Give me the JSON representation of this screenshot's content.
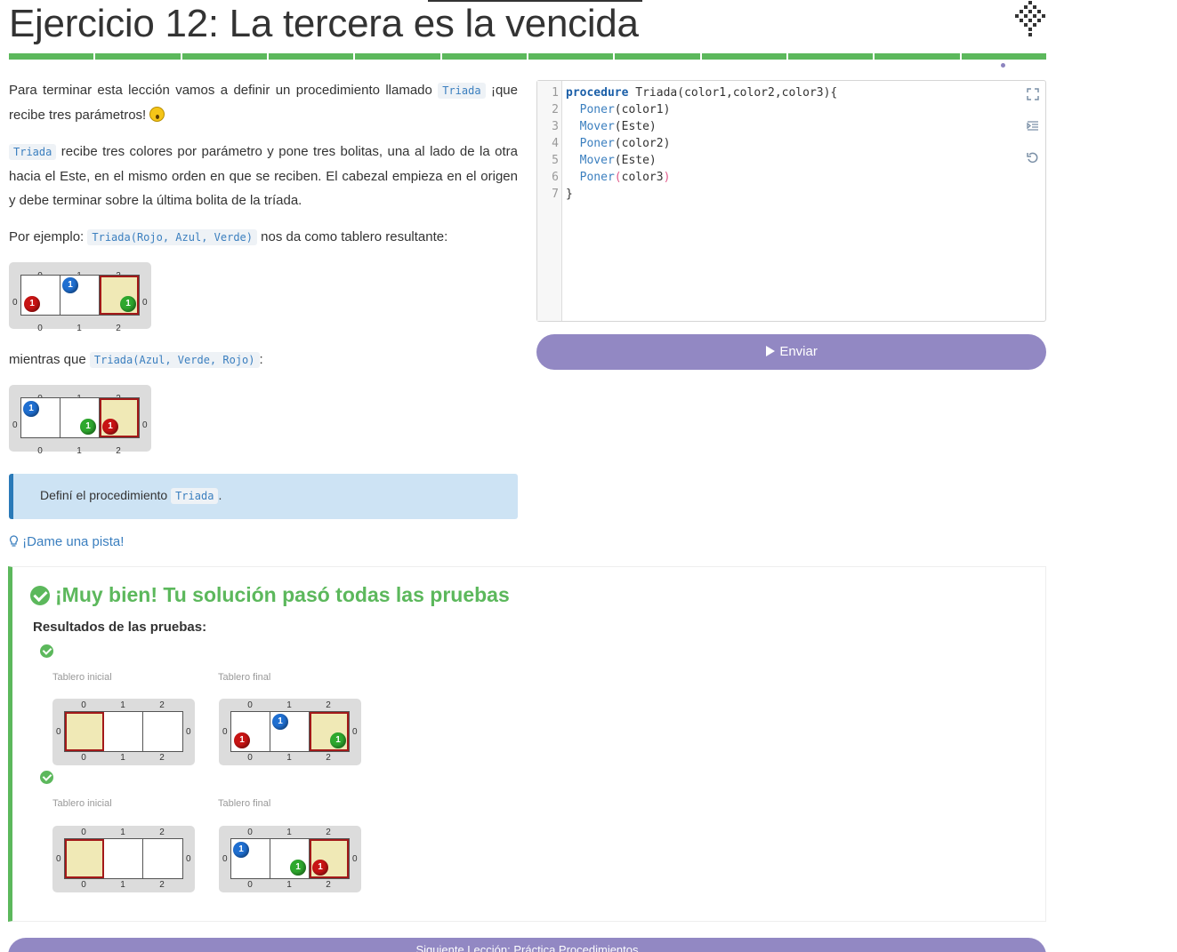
{
  "header": {
    "title": "Ejercicio 12: La tercera es la vencida",
    "progress_segments": 12
  },
  "statement": {
    "p1_before": "Para terminar esta lección vamos a definir un procedimiento llamado ",
    "p1_code": "Triada",
    "p1_after": " ¡que recibe tres parámetros! ",
    "p2_code": "Triada",
    "p2_after": " recibe tres colores por parámetro y pone tres bolitas, una al lado de la otra hacia el Este, en el mismo orden en que se reciben. El cabezal empieza en el origen y debe terminar sobre la última bolita de la tríada.",
    "p3_before": "Por ejemplo: ",
    "p3_code": "Triada(Rojo, Azul, Verde)",
    "p3_after": " nos da como tablero resultante:",
    "p4_before": "mientras que ",
    "p4_code": "Triada(Azul, Verde, Rojo)",
    "p4_after": ":",
    "callout_before": "Definí el procedimiento ",
    "callout_code": "Triada",
    "callout_after": ".",
    "hint": "¡Dame una pista!"
  },
  "board_labels": {
    "c0": "0",
    "c1": "1",
    "c2": "2",
    "r0": "0",
    "ball": "1"
  },
  "editor": {
    "line_numbers": [
      "1",
      "2",
      "3",
      "4",
      "5",
      "6",
      "7"
    ],
    "l1_kw": "procedure",
    "l1_rest": " Triada(color1,color2,color3){",
    "l2_fn": "Poner",
    "l2_rest": "(color1)",
    "l3_fn": "Mover",
    "l3_rest": "(Este)",
    "l4_fn": "Poner",
    "l4_rest": "(color2)",
    "l5_fn": "Mover",
    "l5_rest": "(Este)",
    "l6_fn": "Poner",
    "l6_open": "(",
    "l6_rest": "color3",
    "l6_close": ")",
    "l7": "}",
    "icons": [
      "expand-icon",
      "indent-icon",
      "reset-icon"
    ]
  },
  "submit": {
    "label": "Enviar"
  },
  "result": {
    "title": "¡Muy bien! Tu solución pasó todas las pruebas",
    "subtitle": "Resultados de las pruebas:",
    "initial_label": "Tablero inicial",
    "final_label": "Tablero final"
  },
  "bottom_button": {
    "label": "Siguiente Lección: Práctica Procedimientos"
  },
  "colors": {
    "accent": "#9288c3",
    "success": "#5cb85c",
    "link": "#3b7fbf",
    "callout_bg": "#cde3f4",
    "head_border": "#a31919"
  }
}
